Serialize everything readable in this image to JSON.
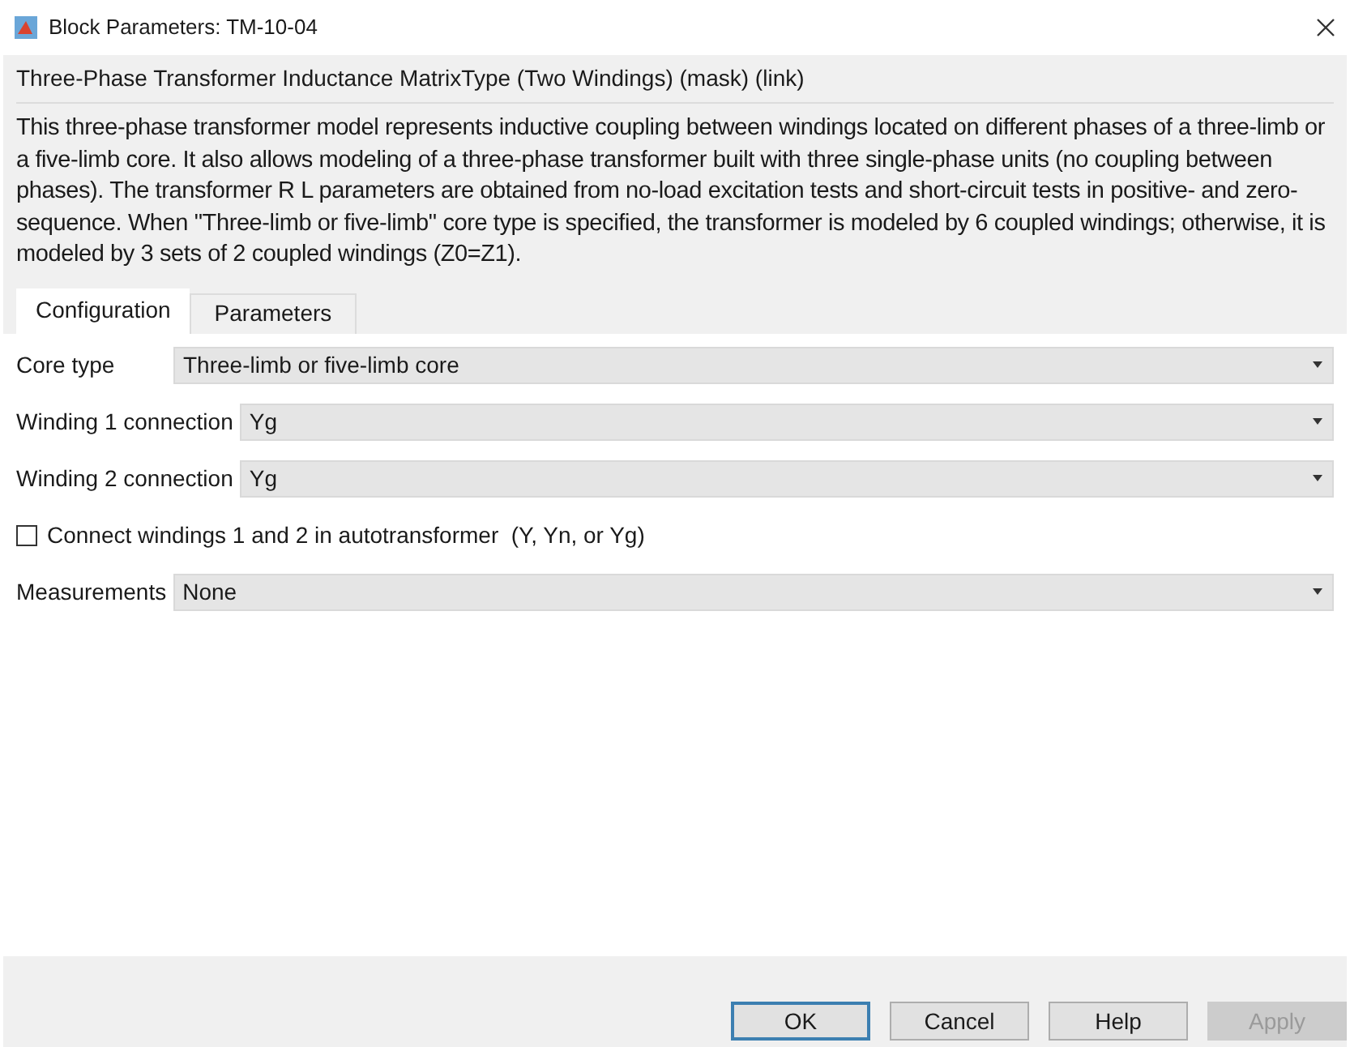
{
  "window": {
    "title": "Block Parameters: TM-10-04"
  },
  "header": {
    "title": "Three-Phase Transformer Inductance MatrixType (Two Windings) (mask) (link)",
    "description": "This three-phase transformer model represents inductive coupling between windings located on different phases of a three-limb or a five-limb core.  It also allows modeling of a three-phase transformer built with three single-phase units (no coupling between phases). The transformer R L parameters are obtained from no-load excitation tests and short-circuit tests in positive- and zero-sequence. When \"Three-limb or five-limb\" core type is specified, the transformer is modeled by 6 coupled windings; otherwise, it is modeled by 3 sets of 2 coupled windings (Z0=Z1)."
  },
  "tabs": [
    {
      "label": "Configuration",
      "selected": true
    },
    {
      "label": "Parameters",
      "selected": false
    }
  ],
  "fields": [
    {
      "kind": "dropdown",
      "label": "Core type",
      "value": "Three-limb or five-limb core"
    },
    {
      "kind": "dropdown",
      "label": "Winding 1 connection",
      "value": "Yg"
    },
    {
      "kind": "dropdown",
      "label": "Winding 2 connection",
      "value": "Yg"
    },
    {
      "kind": "checkbox",
      "label": "Connect windings 1 and 2 in autotransformer  (Y, Yn, or Yg)",
      "checked": false
    },
    {
      "kind": "dropdown",
      "label": "Measurements",
      "value": "None"
    }
  ],
  "buttons": [
    {
      "label": "OK",
      "default": true,
      "disabled": false
    },
    {
      "label": "Cancel",
      "default": false,
      "disabled": false
    },
    {
      "label": "Help",
      "default": false,
      "disabled": false
    },
    {
      "label": "Apply",
      "default": false,
      "disabled": true
    }
  ]
}
